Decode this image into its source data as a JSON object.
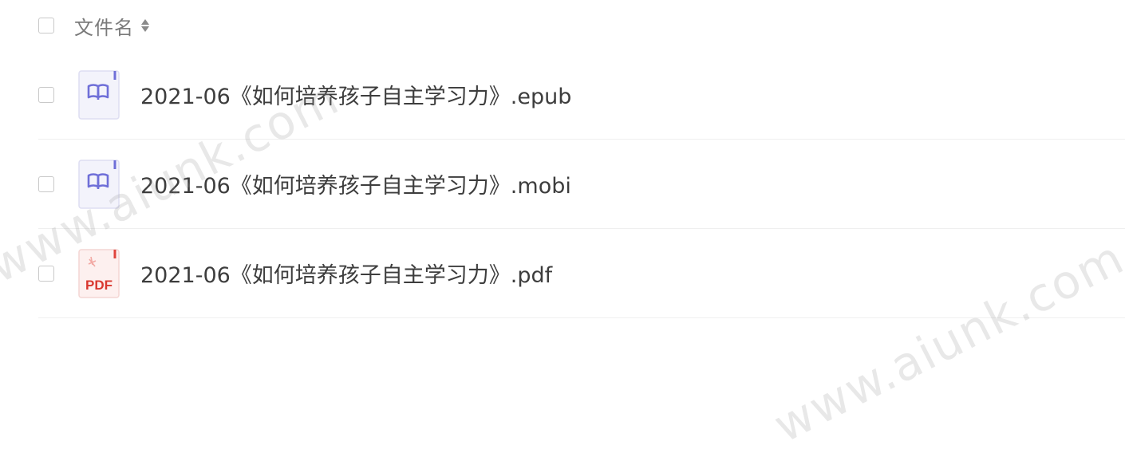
{
  "header": {
    "column_label": "文件名"
  },
  "files": [
    {
      "name": "2021-06《如何培养孩子自主学习力》.epub",
      "icon": "ebook-icon"
    },
    {
      "name": "2021-06《如何培养孩子自主学习力》.mobi",
      "icon": "ebook-icon"
    },
    {
      "name": "2021-06《如何培养孩子自主学习力》.pdf",
      "icon": "pdf-icon",
      "icon_text": "PDF"
    }
  ],
  "watermarks": [
    "www.aiunk.com",
    "www.aiunk.com"
  ],
  "colors": {
    "ebook_accent": "#6f6fd8",
    "pdf_accent": "#e0443c",
    "divider": "#efefef"
  }
}
